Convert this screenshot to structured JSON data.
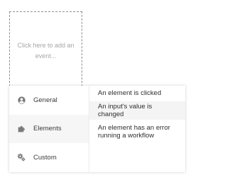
{
  "add_event": {
    "placeholder_text": "Click here to add an event..."
  },
  "categories": [
    {
      "label": "General",
      "icon": "user-circle-icon"
    },
    {
      "label": "Elements",
      "icon": "puzzle-piece-icon"
    },
    {
      "label": "Custom",
      "icon": "gears-icon"
    }
  ],
  "events": [
    {
      "label": "An element is clicked"
    },
    {
      "label": "An input's value is changed"
    },
    {
      "label": "An element has an error running a workflow"
    }
  ],
  "colors": {
    "icon": "#7a7a7a",
    "active_background": "#f6f6f6"
  }
}
